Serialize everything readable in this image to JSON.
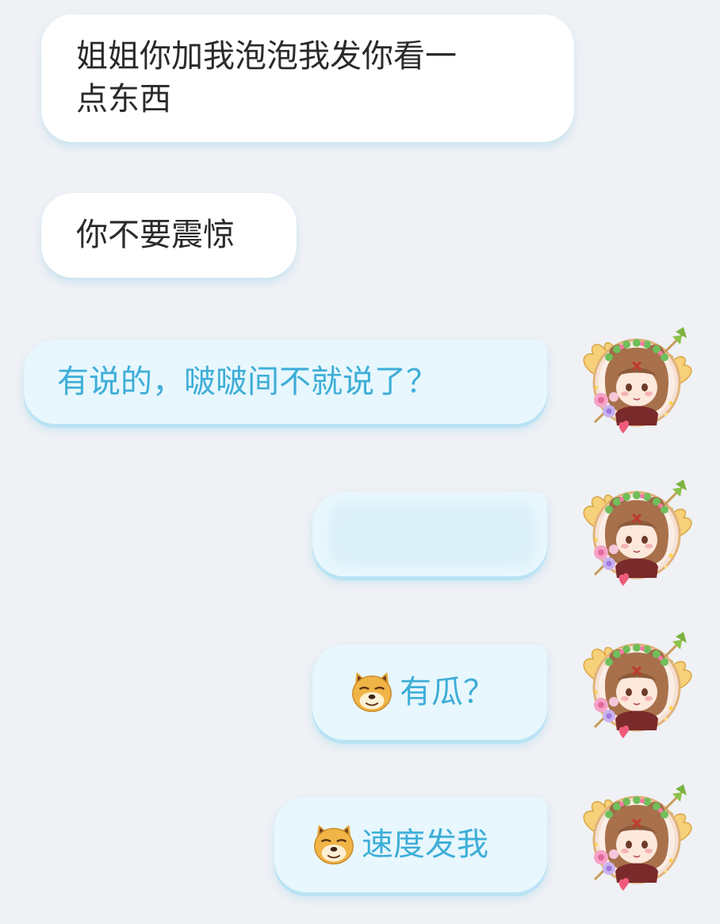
{
  "messages": [
    {
      "id": "m1",
      "direction": "incoming",
      "text": "姐姐你加我泡泡我发你看一\n点东西"
    },
    {
      "id": "m2",
      "direction": "incoming",
      "text": "你不要震惊"
    },
    {
      "id": "m3",
      "direction": "outgoing",
      "text": "有说的，啵啵间不就说了？"
    },
    {
      "id": "m4",
      "direction": "outgoing",
      "text": "",
      "content": "blurred-redacted"
    },
    {
      "id": "m5",
      "direction": "outgoing",
      "emoji": "doge-emoji",
      "text": "有瓜？"
    },
    {
      "id": "m6",
      "direction": "outgoing",
      "emoji": "doge-emoji",
      "text": "速度发我"
    }
  ],
  "colors": {
    "background": "#eff1f5",
    "incoming_bubble": "#ffffff",
    "incoming_text": "#2a2a2a",
    "outgoing_bubble": "#e7f7fd",
    "outgoing_text": "#3eaed8",
    "outgoing_shadow": "#b9e3f4"
  },
  "avatar": {
    "icon": "anime-girl-avatar-icon"
  }
}
